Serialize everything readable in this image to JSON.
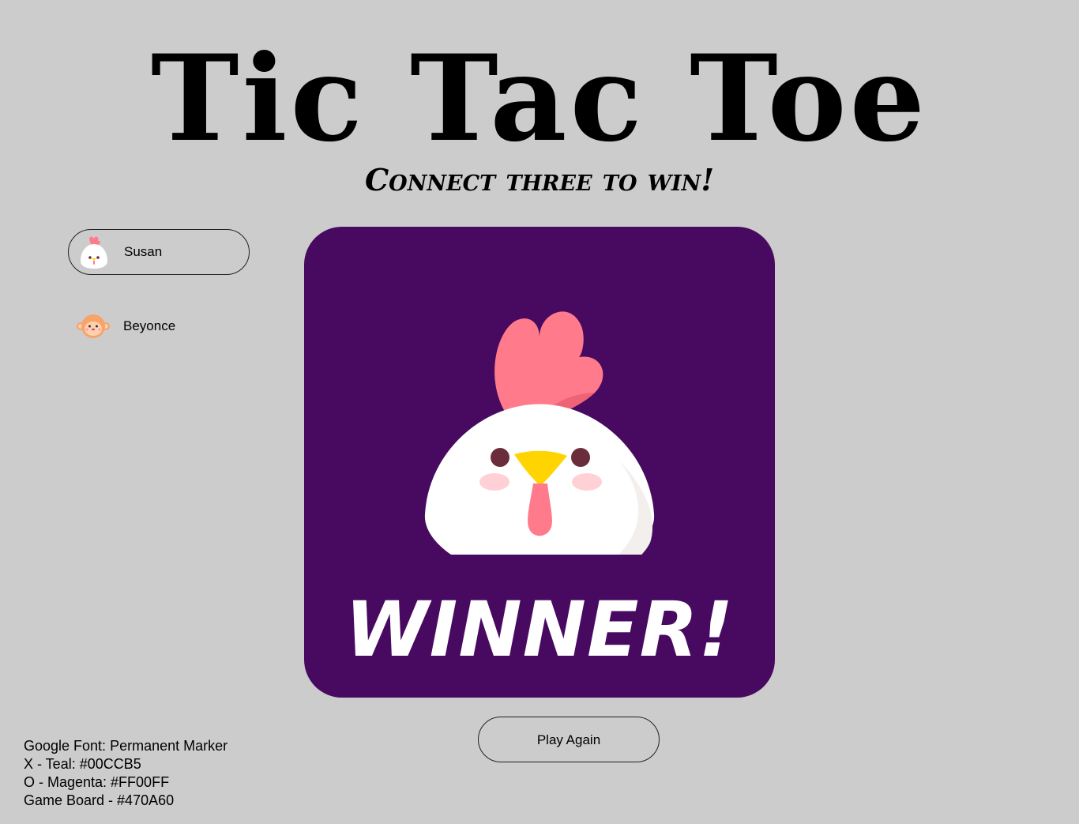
{
  "title": "Tic Tac Toe",
  "subtitle": "Connect three to win!",
  "players": [
    {
      "name": "Susan",
      "avatar_icon": "chicken-icon",
      "active": true
    },
    {
      "name": "Beyonce",
      "avatar_icon": "monkey-icon",
      "active": false
    }
  ],
  "board": {
    "background": "#470A60",
    "winner_icon": "chicken-icon",
    "winner_text": "WINNER!"
  },
  "play_again_label": "Play Again",
  "notes": [
    "Google Font: Permanent Marker",
    "X - Teal: #00CCB5",
    "O - Magenta: #FF00FF",
    "Game Board - #470A60"
  ],
  "colors": {
    "background": "#CCCCCC",
    "x_teal": "#00CCB5",
    "o_magenta": "#FF00FF",
    "board": "#470A60"
  }
}
